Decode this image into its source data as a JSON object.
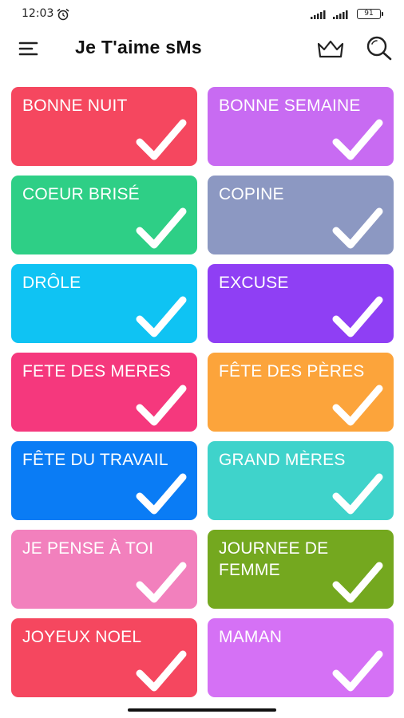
{
  "status_bar": {
    "time": "12:03",
    "battery": "91",
    "icons": [
      "alarm-icon",
      "signal-icon",
      "signal-icon",
      "battery-icon"
    ]
  },
  "app_bar": {
    "title": "Je T'aime sMs",
    "icons": [
      "menu-icon",
      "crown-icon",
      "search-icon"
    ]
  },
  "categories": [
    {
      "label": "BONNE NUIT",
      "color": "#f5475f"
    },
    {
      "label": "BONNE SEMAINE",
      "color": "#c86bf2"
    },
    {
      "label": "COEUR BRISÉ",
      "color": "#2ecf86"
    },
    {
      "label": "COPINE",
      "color": "#8c98c2"
    },
    {
      "label": "DRÔLE",
      "color": "#0fc3f3"
    },
    {
      "label": "EXCUSE",
      "color": "#8f3ff4"
    },
    {
      "label": "FETE DES MERES",
      "color": "#f5387d"
    },
    {
      "label": "FÊTE DES PÈRES",
      "color": "#fca43b"
    },
    {
      "label": "FÊTE DU TRAVAIL",
      "color": "#0a7cf5"
    },
    {
      "label": "GRAND MÈRES",
      "color": "#3fd3cb"
    },
    {
      "label": "JE PENSE À TOI",
      "color": "#f280bd"
    },
    {
      "label": "JOURNEE DE FEMME",
      "color": "#74a81f"
    },
    {
      "label": "JOYEUX NOEL",
      "color": "#f5475f"
    },
    {
      "label": "MAMAN",
      "color": "#d571f5"
    }
  ],
  "card_icon": "check-icon"
}
